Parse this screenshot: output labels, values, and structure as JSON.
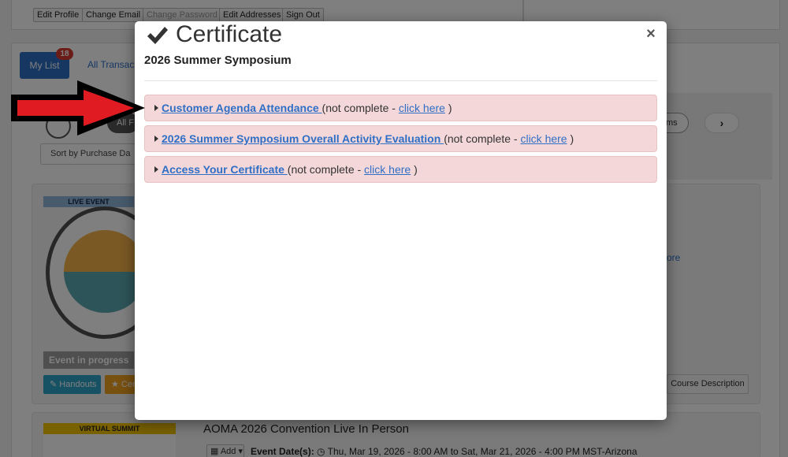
{
  "account": {
    "buttons": [
      "Edit Profile",
      "Change Email",
      "Change Password",
      "Edit Addresses",
      "Sign Out"
    ]
  },
  "tabs": {
    "my_list": "My List",
    "my_list_count": "18",
    "all_transactions": "All Transac"
  },
  "filters": {
    "all_label": "All F",
    "sort_label": "Sort by Purchase Da",
    "ms_label": "ms",
    "next_icon": "chevron-right-icon"
  },
  "card1": {
    "tag": "LIVE EVENT",
    "status": "Event in progress",
    "handouts": "Handouts",
    "certificate": "Cer",
    "more": "ore",
    "course_description": "Course Description"
  },
  "card2": {
    "tag": "VIRTUAL SUMMIT",
    "title": "AOMA 2026 Convention Live In Person",
    "add": "Add",
    "dates_label": "Event Date(s):",
    "dates_value": "Thu, Mar 19, 2026 - 8:00 AM to Sat, Mar 21, 2026 - 4:00 PM MST-Arizona"
  },
  "modal": {
    "icon": "checkmark-icon",
    "title": "Certificate",
    "subtitle": "2026 Summer Symposium",
    "close": "×",
    "tasks": [
      {
        "label": "Customer Agenda Attendance ",
        "status": " (not complete - ",
        "action": "click here",
        "end": " )"
      },
      {
        "label": "2026 Summer Symposium Overall Activity Evaluation ",
        "status": " (not complete - ",
        "action": "click here",
        "end": " )"
      },
      {
        "label": "Access Your Certificate ",
        "status": " (not complete - ",
        "action": "click here",
        "end": " )"
      }
    ]
  },
  "colors": {
    "task_background": "#f4d7d8",
    "link": "#2f6fc6",
    "arrow_fill": "#e11b22"
  }
}
